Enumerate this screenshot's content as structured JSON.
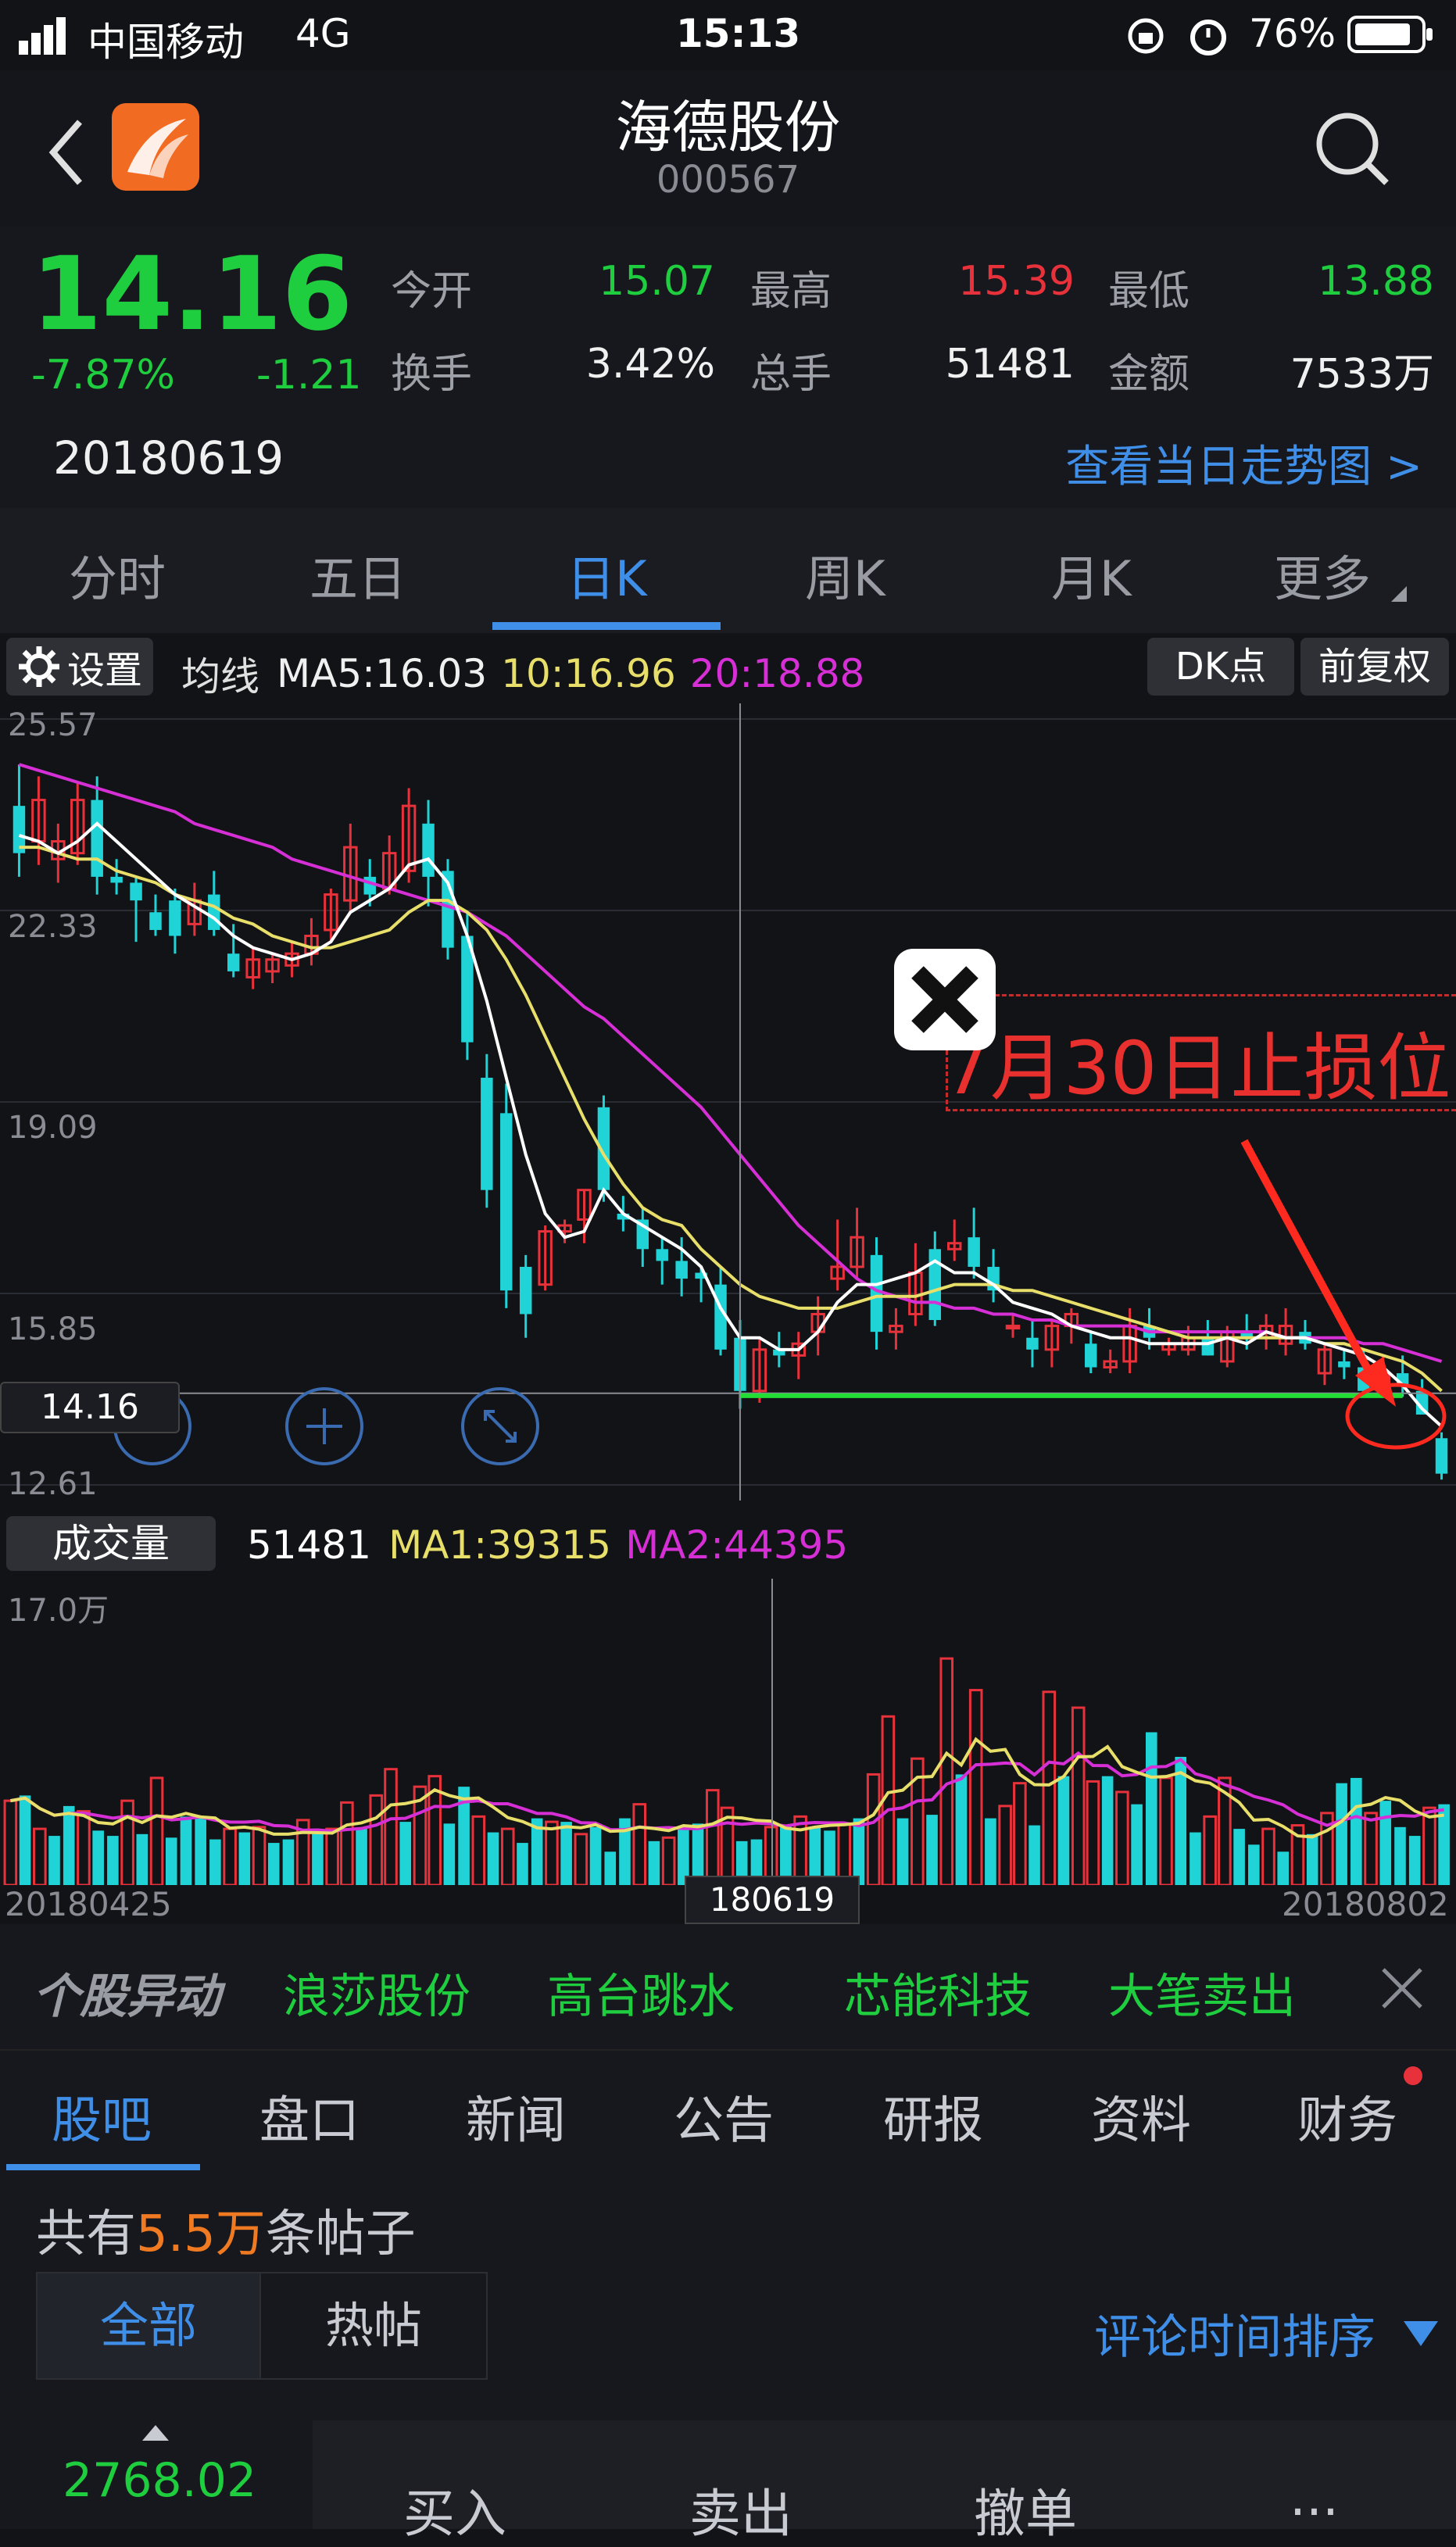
{
  "status_bar": {
    "carrier": "中国移动",
    "network": "4G",
    "time": "15:13",
    "battery": "76%"
  },
  "header": {
    "stock_name": "海德股份",
    "stock_code": "000567",
    "back_icon": "chevron-left-icon",
    "search_icon": "search-icon",
    "app_logo": "app-logo"
  },
  "quote": {
    "price": "14.16",
    "change_pct": "-7.87%",
    "change": "-1.21",
    "date": "20180619",
    "open_label": "今开",
    "open": "15.07",
    "high_label": "最高",
    "high": "15.39",
    "low_label": "最低",
    "low": "13.88",
    "turnover_label": "换手",
    "turnover": "3.42%",
    "volume_label": "总手",
    "volume": "51481",
    "amount_label": "金额",
    "amount": "7533万",
    "intraday_link": "查看当日走势图 >"
  },
  "chart_tabs": {
    "items": [
      "分时",
      "五日",
      "日K",
      "周K",
      "月K",
      "更多"
    ],
    "active": "日K"
  },
  "chart_toolbar": {
    "settings_label": "设置",
    "ma_prefix": "均线",
    "ma5": "MA5:16.03",
    "ma10": "10:16.96",
    "ma20": "20:18.88",
    "dk_button": "DK点",
    "adjust_button": "前复权"
  },
  "price_axis": {
    "labels": [
      "25.57",
      "22.33",
      "19.09",
      "15.85",
      "12.61"
    ],
    "crosshair_value": "14.16"
  },
  "annotation": {
    "text": "7月30日止损位",
    "close_icon": "close-icon"
  },
  "volume_toolbar": {
    "label": "成交量",
    "volume": "51481",
    "ma1": "MA1:39315",
    "ma2": "MA2:44395",
    "axis_max": "17.0万"
  },
  "date_axis": {
    "start": "20180425",
    "crosshair": "180619",
    "end": "20180802"
  },
  "ticker": {
    "brand": "个股异动",
    "items": [
      "浪莎股份",
      "高台跳水",
      "芯能科技",
      "大笔卖出"
    ]
  },
  "sub_tabs": {
    "items": [
      "股吧",
      "盘口",
      "新闻",
      "公告",
      "研报",
      "资料",
      "财务"
    ],
    "active": "股吧"
  },
  "posts": {
    "prefix": "共有",
    "count": "5.5万",
    "suffix": "条帖子",
    "filter_all": "全部",
    "filter_hot": "热帖",
    "sort_label": "评论时间排序"
  },
  "trade_bar": {
    "index_value": "2768.02",
    "buy": "买入",
    "sell": "卖出",
    "cancel": "撤单",
    "more": "..."
  },
  "colors": {
    "up": "#e8323b",
    "down": "#1fd3d6",
    "ma5": "#ffffff",
    "ma10": "#e8df6a",
    "ma20": "#d62fd6",
    "support": "#22dd33",
    "accent": "#3f8fe8"
  },
  "chart_data": {
    "type": "candlestick",
    "price_range": [
      12.61,
      25.57
    ],
    "candles": [
      {
        "o": 24.1,
        "h": 24.8,
        "l": 22.9,
        "c": 23.3
      },
      {
        "o": 23.5,
        "h": 24.6,
        "l": 23.1,
        "c": 24.2
      },
      {
        "o": 23.2,
        "h": 23.8,
        "l": 22.8,
        "c": 23.5
      },
      {
        "o": 23.3,
        "h": 24.5,
        "l": 23.1,
        "c": 24.2
      },
      {
        "o": 24.2,
        "h": 24.6,
        "l": 22.6,
        "c": 22.9
      },
      {
        "o": 22.9,
        "h": 23.2,
        "l": 22.6,
        "c": 22.8
      },
      {
        "o": 22.8,
        "h": 22.9,
        "l": 21.8,
        "c": 22.5
      },
      {
        "o": 22.3,
        "h": 22.6,
        "l": 21.9,
        "c": 22.0
      },
      {
        "o": 22.5,
        "h": 22.7,
        "l": 21.6,
        "c": 21.9
      },
      {
        "o": 22.1,
        "h": 22.8,
        "l": 21.9,
        "c": 22.5
      },
      {
        "o": 22.6,
        "h": 23.0,
        "l": 21.9,
        "c": 22.0
      },
      {
        "o": 21.6,
        "h": 22.1,
        "l": 21.2,
        "c": 21.3
      },
      {
        "o": 21.2,
        "h": 21.7,
        "l": 21.0,
        "c": 21.5
      },
      {
        "o": 21.3,
        "h": 21.6,
        "l": 21.1,
        "c": 21.5
      },
      {
        "o": 21.4,
        "h": 21.8,
        "l": 21.2,
        "c": 21.6
      },
      {
        "o": 21.6,
        "h": 22.2,
        "l": 21.4,
        "c": 21.9
      },
      {
        "o": 22.0,
        "h": 22.7,
        "l": 21.8,
        "c": 22.6
      },
      {
        "o": 22.5,
        "h": 23.8,
        "l": 22.3,
        "c": 23.4
      },
      {
        "o": 22.9,
        "h": 23.2,
        "l": 22.4,
        "c": 22.6
      },
      {
        "o": 22.7,
        "h": 23.6,
        "l": 22.6,
        "c": 23.3
      },
      {
        "o": 23.0,
        "h": 24.4,
        "l": 22.8,
        "c": 24.1
      },
      {
        "o": 23.8,
        "h": 24.2,
        "l": 22.4,
        "c": 22.9
      },
      {
        "o": 23.0,
        "h": 23.2,
        "l": 21.5,
        "c": 21.7
      },
      {
        "o": 21.9,
        "h": 22.3,
        "l": 19.8,
        "c": 20.1
      },
      {
        "o": 19.5,
        "h": 19.9,
        "l": 17.3,
        "c": 17.6
      },
      {
        "o": 18.9,
        "h": 19.4,
        "l": 15.6,
        "c": 15.9
      },
      {
        "o": 16.3,
        "h": 16.5,
        "l": 15.1,
        "c": 15.5
      },
      {
        "o": 16.0,
        "h": 17.0,
        "l": 15.9,
        "c": 16.9
      },
      {
        "o": 16.9,
        "h": 17.1,
        "l": 16.7,
        "c": 17.0
      },
      {
        "o": 17.1,
        "h": 17.6,
        "l": 16.7,
        "c": 17.6
      },
      {
        "o": 19.0,
        "h": 19.2,
        "l": 17.4,
        "c": 17.6
      },
      {
        "o": 17.2,
        "h": 17.5,
        "l": 16.9,
        "c": 17.1
      },
      {
        "o": 17.1,
        "h": 17.3,
        "l": 16.3,
        "c": 16.6
      },
      {
        "o": 16.6,
        "h": 16.8,
        "l": 16.0,
        "c": 16.4
      },
      {
        "o": 16.4,
        "h": 16.8,
        "l": 15.8,
        "c": 16.1
      },
      {
        "o": 16.2,
        "h": 16.3,
        "l": 15.7,
        "c": 16.1
      },
      {
        "o": 16.0,
        "h": 16.3,
        "l": 14.8,
        "c": 14.9
      },
      {
        "o": 15.1,
        "h": 15.4,
        "l": 13.9,
        "c": 14.2
      },
      {
        "o": 14.2,
        "h": 15.1,
        "l": 14.0,
        "c": 14.9
      },
      {
        "o": 14.9,
        "h": 15.2,
        "l": 14.6,
        "c": 14.8
      },
      {
        "o": 14.8,
        "h": 15.2,
        "l": 14.4,
        "c": 15.0
      },
      {
        "o": 15.2,
        "h": 15.8,
        "l": 14.8,
        "c": 15.5
      },
      {
        "o": 16.1,
        "h": 17.1,
        "l": 15.9,
        "c": 16.3
      },
      {
        "o": 16.3,
        "h": 17.3,
        "l": 16.1,
        "c": 16.8
      },
      {
        "o": 16.5,
        "h": 16.8,
        "l": 14.9,
        "c": 15.2
      },
      {
        "o": 15.2,
        "h": 15.6,
        "l": 14.9,
        "c": 15.3
      },
      {
        "o": 15.5,
        "h": 16.7,
        "l": 15.3,
        "c": 16.2
      },
      {
        "o": 16.6,
        "h": 16.9,
        "l": 15.3,
        "c": 15.4
      },
      {
        "o": 16.6,
        "h": 17.1,
        "l": 16.4,
        "c": 16.7
      },
      {
        "o": 16.8,
        "h": 17.3,
        "l": 16.1,
        "c": 16.3
      },
      {
        "o": 16.3,
        "h": 16.6,
        "l": 15.7,
        "c": 15.9
      },
      {
        "o": 15.3,
        "h": 15.5,
        "l": 15.1,
        "c": 15.3
      },
      {
        "o": 15.1,
        "h": 15.4,
        "l": 14.6,
        "c": 14.9
      },
      {
        "o": 14.9,
        "h": 15.4,
        "l": 14.6,
        "c": 15.3
      },
      {
        "o": 15.3,
        "h": 15.6,
        "l": 15.0,
        "c": 15.5
      },
      {
        "o": 15.0,
        "h": 15.2,
        "l": 14.5,
        "c": 14.6
      },
      {
        "o": 14.6,
        "h": 14.9,
        "l": 14.5,
        "c": 14.7
      },
      {
        "o": 14.7,
        "h": 15.6,
        "l": 14.5,
        "c": 15.3
      },
      {
        "o": 15.3,
        "h": 15.6,
        "l": 14.9,
        "c": 15.1
      },
      {
        "o": 14.9,
        "h": 15.1,
        "l": 14.8,
        "c": 15.0
      },
      {
        "o": 14.9,
        "h": 15.3,
        "l": 14.8,
        "c": 15.1
      },
      {
        "o": 15.1,
        "h": 15.4,
        "l": 14.8,
        "c": 14.8
      },
      {
        "o": 14.7,
        "h": 15.3,
        "l": 14.6,
        "c": 15.2
      },
      {
        "o": 15.2,
        "h": 15.5,
        "l": 14.9,
        "c": 15.1
      },
      {
        "o": 15.1,
        "h": 15.5,
        "l": 14.9,
        "c": 15.3
      },
      {
        "o": 15.0,
        "h": 15.6,
        "l": 14.8,
        "c": 15.3
      },
      {
        "o": 15.2,
        "h": 15.4,
        "l": 14.9,
        "c": 15.0
      },
      {
        "o": 14.5,
        "h": 15.0,
        "l": 14.3,
        "c": 14.9
      },
      {
        "o": 14.7,
        "h": 14.9,
        "l": 14.4,
        "c": 14.6
      },
      {
        "o": 14.6,
        "h": 14.9,
        "l": 14.1,
        "c": 14.2
      },
      {
        "o": 14.3,
        "h": 14.8,
        "l": 14.1,
        "c": 14.5
      },
      {
        "o": 14.5,
        "h": 14.8,
        "l": 14.1,
        "c": 14.3
      },
      {
        "o": 14.2,
        "h": 14.4,
        "l": 13.8,
        "c": 13.8
      },
      {
        "o": 13.4,
        "h": 13.5,
        "l": 12.7,
        "c": 12.8
      }
    ],
    "ma5": [
      23.6,
      23.5,
      23.3,
      23.5,
      23.8,
      23.5,
      23.2,
      22.9,
      22.6,
      22.4,
      22.2,
      21.9,
      21.7,
      21.6,
      21.5,
      21.6,
      21.8,
      22.3,
      22.5,
      22.7,
      23.1,
      23.2,
      22.8,
      21.9,
      20.8,
      19.5,
      18.2,
      17.2,
      16.8,
      16.9,
      17.6,
      17.2,
      17.0,
      16.8,
      16.6,
      16.3,
      15.6,
      15.1,
      15.1,
      14.9,
      14.9,
      15.2,
      15.7,
      16.0,
      16.0,
      16.1,
      16.2,
      16.4,
      16.2,
      16.2,
      16.0,
      15.7,
      15.6,
      15.5,
      15.3,
      15.2,
      15.1,
      15.1,
      15.0,
      15.0,
      15.0,
      15.0,
      15.1,
      15.0,
      15.2,
      15.1,
      15.1,
      15.0,
      14.9,
      14.8,
      14.6,
      14.3,
      13.9,
      13.6
    ],
    "ma10": [
      23.4,
      23.4,
      23.3,
      23.2,
      23.2,
      23.0,
      22.9,
      22.8,
      22.6,
      22.5,
      22.4,
      22.2,
      22.1,
      21.9,
      21.8,
      21.7,
      21.7,
      21.8,
      21.9,
      22.0,
      22.3,
      22.5,
      22.5,
      22.3,
      22.0,
      21.5,
      20.9,
      20.2,
      19.5,
      18.8,
      18.2,
      17.7,
      17.3,
      17.1,
      17.0,
      16.6,
      16.3,
      16.0,
      15.8,
      15.7,
      15.6,
      15.6,
      15.6,
      15.7,
      15.8,
      15.8,
      15.8,
      15.9,
      16.0,
      16.0,
      16.0,
      15.9,
      15.9,
      15.8,
      15.7,
      15.6,
      15.5,
      15.4,
      15.3,
      15.2,
      15.1,
      15.1,
      15.1,
      15.1,
      15.1,
      15.1,
      15.1,
      15.0,
      15.0,
      14.9,
      14.8,
      14.7,
      14.5,
      14.2
    ],
    "ma20": [
      24.8,
      24.7,
      24.6,
      24.5,
      24.4,
      24.3,
      24.2,
      24.1,
      24.0,
      23.8,
      23.7,
      23.6,
      23.5,
      23.4,
      23.2,
      23.1,
      23.0,
      22.9,
      22.8,
      22.7,
      22.6,
      22.5,
      22.4,
      22.3,
      22.1,
      21.9,
      21.6,
      21.3,
      21.0,
      20.7,
      20.5,
      20.2,
      19.9,
      19.6,
      19.3,
      19.0,
      18.6,
      18.2,
      17.8,
      17.4,
      17.0,
      16.7,
      16.4,
      16.1,
      15.9,
      15.8,
      15.7,
      15.7,
      15.6,
      15.6,
      15.5,
      15.5,
      15.4,
      15.4,
      15.3,
      15.3,
      15.3,
      15.3,
      15.2,
      15.2,
      15.2,
      15.2,
      15.2,
      15.2,
      15.2,
      15.1,
      15.1,
      15.1,
      15.1,
      15.0,
      15.0,
      14.9,
      14.8,
      14.7
    ],
    "volume": [
      4.8,
      5.1,
      3.2,
      2.8,
      4.5,
      4.2,
      3.1,
      2.8,
      4.8,
      2.9,
      6.1,
      2.7,
      3.9,
      3.8,
      2.6,
      3.2,
      3.0,
      3.3,
      2.4,
      2.6,
      3.7,
      2.9,
      3.2,
      4.7,
      3.2,
      5.1,
      6.6,
      3.6,
      5.6,
      6.2,
      3.5,
      5.6,
      3.9,
      3.0,
      3.2,
      2.4,
      3.8,
      3.6,
      3.6,
      2.9,
      3.3,
      1.9,
      3.8,
      4.6,
      2.5,
      2.7,
      3.3,
      3.5,
      5.4,
      4.4,
      2.5,
      2.6,
      3.3,
      3.4,
      3.9,
      3.3,
      3.1,
      3.5,
      3.8,
      6.3,
      9.6,
      3.8,
      7.2,
      4.0,
      12.9,
      6.3,
      11.1,
      3.8,
      4.5,
      5.8,
      3.4,
      11.0,
      6.2,
      10.1,
      5.9,
      6.2,
      5.3,
      4.6,
      8.7,
      6.1,
      7.3,
      3.0,
      3.9,
      6.1,
      3.2,
      2.3,
      3.2,
      1.9,
      3.4,
      2.9,
      4.1,
      5.8,
      6.1,
      4.1,
      4.8,
      3.3,
      2.8,
      4.4,
      4.6
    ],
    "volume_range": [
      0,
      17.0
    ]
  }
}
